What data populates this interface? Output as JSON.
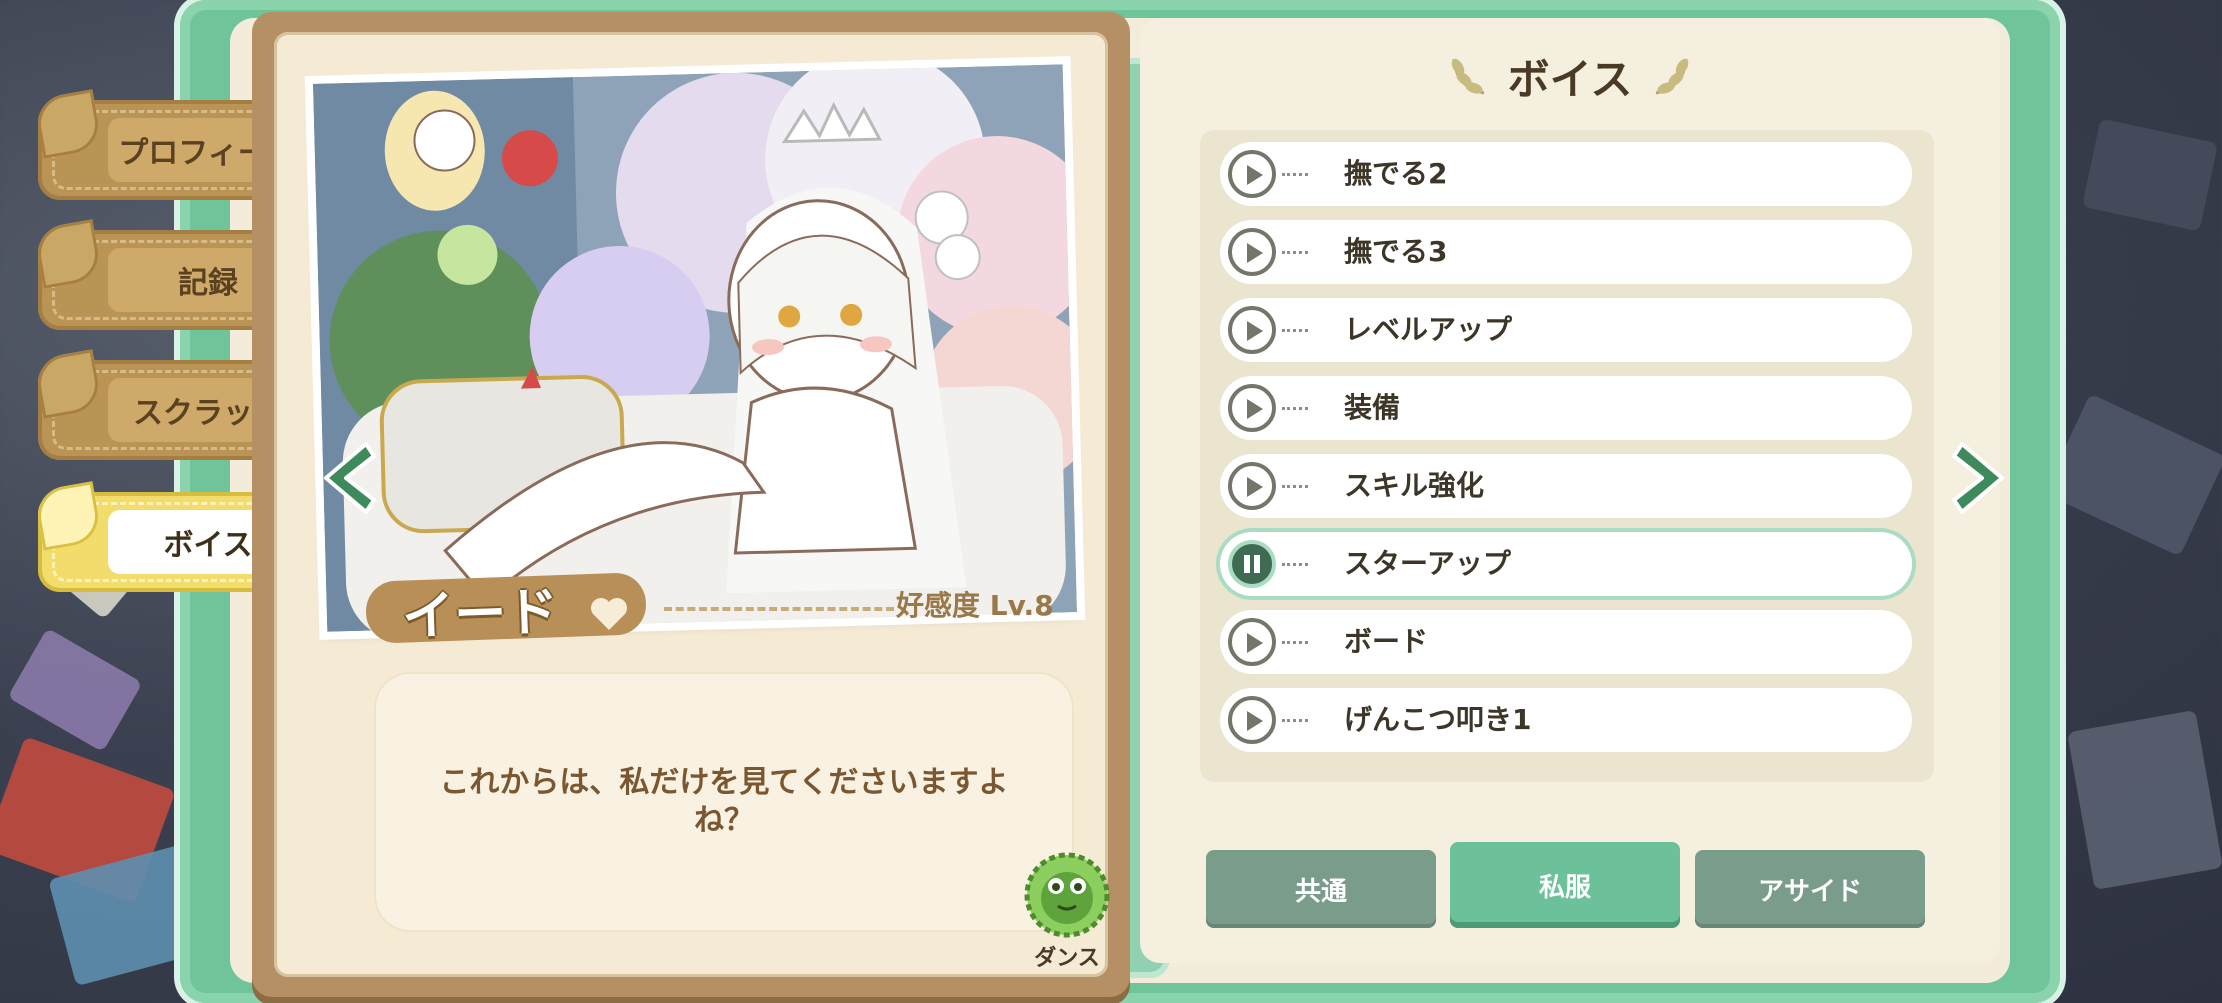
{
  "sidebar": {
    "tabs": [
      {
        "label": "プロフィール",
        "active": false
      },
      {
        "label": "記録",
        "active": false
      },
      {
        "label": "スクラップ",
        "active": false
      },
      {
        "label": "ボイス",
        "active": true
      }
    ]
  },
  "character": {
    "name": "イード",
    "affinity": "好感度 Lv.8",
    "quote": "これからは、私だけを見てくださいますよね？",
    "dance_label": "ダンス"
  },
  "voice_panel": {
    "title": "ボイス",
    "items": [
      {
        "label": "撫でる2",
        "playing": false
      },
      {
        "label": "撫でる3",
        "playing": false
      },
      {
        "label": "レベルアップ",
        "playing": false
      },
      {
        "label": "装備",
        "playing": false
      },
      {
        "label": "スキル強化",
        "playing": false
      },
      {
        "label": "スターアップ",
        "playing": true
      },
      {
        "label": "ボード",
        "playing": false
      },
      {
        "label": "げんこつ叩き1",
        "playing": false
      }
    ],
    "categories": [
      {
        "label": "共通",
        "active": false
      },
      {
        "label": "私服",
        "active": true
      },
      {
        "label": "アサイド",
        "active": false
      }
    ]
  },
  "colors": {
    "accent_green": "#6cc19a",
    "tab_active": "#f2dd6c",
    "tab_inactive": "#b99455",
    "card_brown": "#b49064"
  },
  "icons": {
    "prev": "chevron-left-icon",
    "next": "chevron-right-icon",
    "play": "play-icon",
    "pause": "pause-icon",
    "heart": "heart-icon",
    "laurel": "laurel-icon",
    "dance": "frog-icon"
  }
}
